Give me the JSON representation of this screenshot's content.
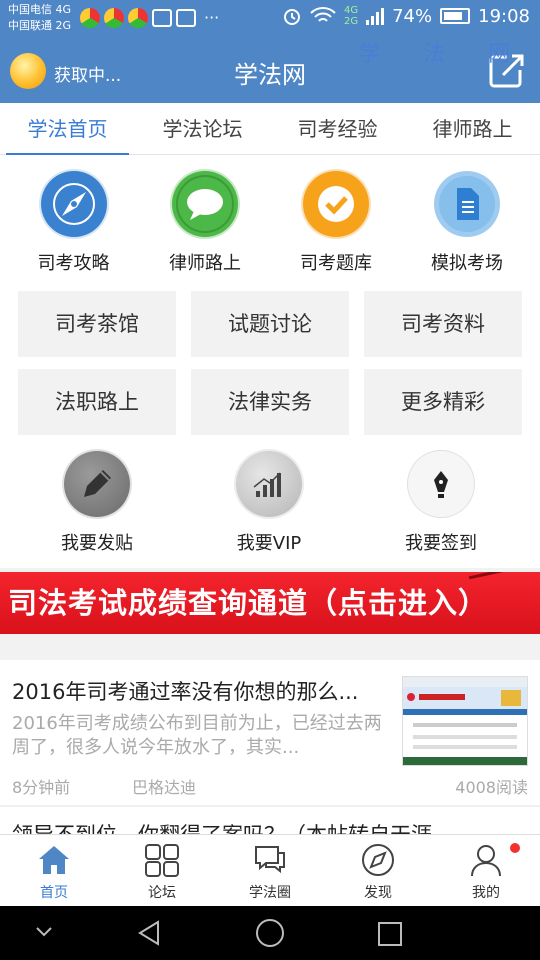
{
  "status_bar": {
    "carrier1": "中国电信 4G",
    "carrier2": "中国联通 2G",
    "net_a": "4G",
    "net_b": "2G",
    "battery": "74%",
    "time": "19:08"
  },
  "watermark": "学 法 网",
  "header": {
    "location": "获取中...",
    "title": "学法网"
  },
  "tabs": [
    {
      "label": "学法首页",
      "active": true
    },
    {
      "label": "学法论坛"
    },
    {
      "label": "司考经验"
    },
    {
      "label": "律师路上"
    }
  ],
  "quick_icons": [
    {
      "label": "司考攻略",
      "icon": "compass-icon",
      "color": "#3a82cf"
    },
    {
      "label": "律师路上",
      "icon": "chat-bubble-icon",
      "color": "#4cb848"
    },
    {
      "label": "司考题库",
      "icon": "checkmark-icon",
      "color": "#f7a21b"
    },
    {
      "label": "模拟考场",
      "icon": "document-icon",
      "color": "#5aa7e6"
    }
  ],
  "grid_buttons": [
    "司考茶馆",
    "试题讨论",
    "司考资料",
    "法职路上",
    "法律实务",
    "更多精彩"
  ],
  "action_icons": [
    {
      "label": "我要发贴",
      "icon": "pencil-icon"
    },
    {
      "label": "我要VIP",
      "icon": "bar-chart-icon"
    },
    {
      "label": "我要签到",
      "icon": "pen-nib-icon"
    }
  ],
  "banner": "司法考试成绩查询通道（点击进入）",
  "news": [
    {
      "title": "2016年司考通过率没有你想的那么...",
      "excerpt": "2016年司考成绩公布到目前为止，已经过去两周了，很多人说今年放水了，其实...",
      "time": "8分钟前",
      "author": "巴格达迪",
      "reads": "4008阅读"
    },
    {
      "title": "领导不到位，你翻得了案吗？（本帖转自天涯"
    }
  ],
  "bottom_nav": [
    {
      "label": "首页",
      "icon": "home-icon",
      "active": true
    },
    {
      "label": "论坛",
      "icon": "grid-icon"
    },
    {
      "label": "学法圈",
      "icon": "chat-icon"
    },
    {
      "label": "发现",
      "icon": "compass-icon"
    },
    {
      "label": "我的",
      "icon": "user-icon"
    }
  ],
  "colors": {
    "primary": "#4f86c6",
    "accent": "#3a7bd5",
    "banner_red": "#e61c24"
  }
}
